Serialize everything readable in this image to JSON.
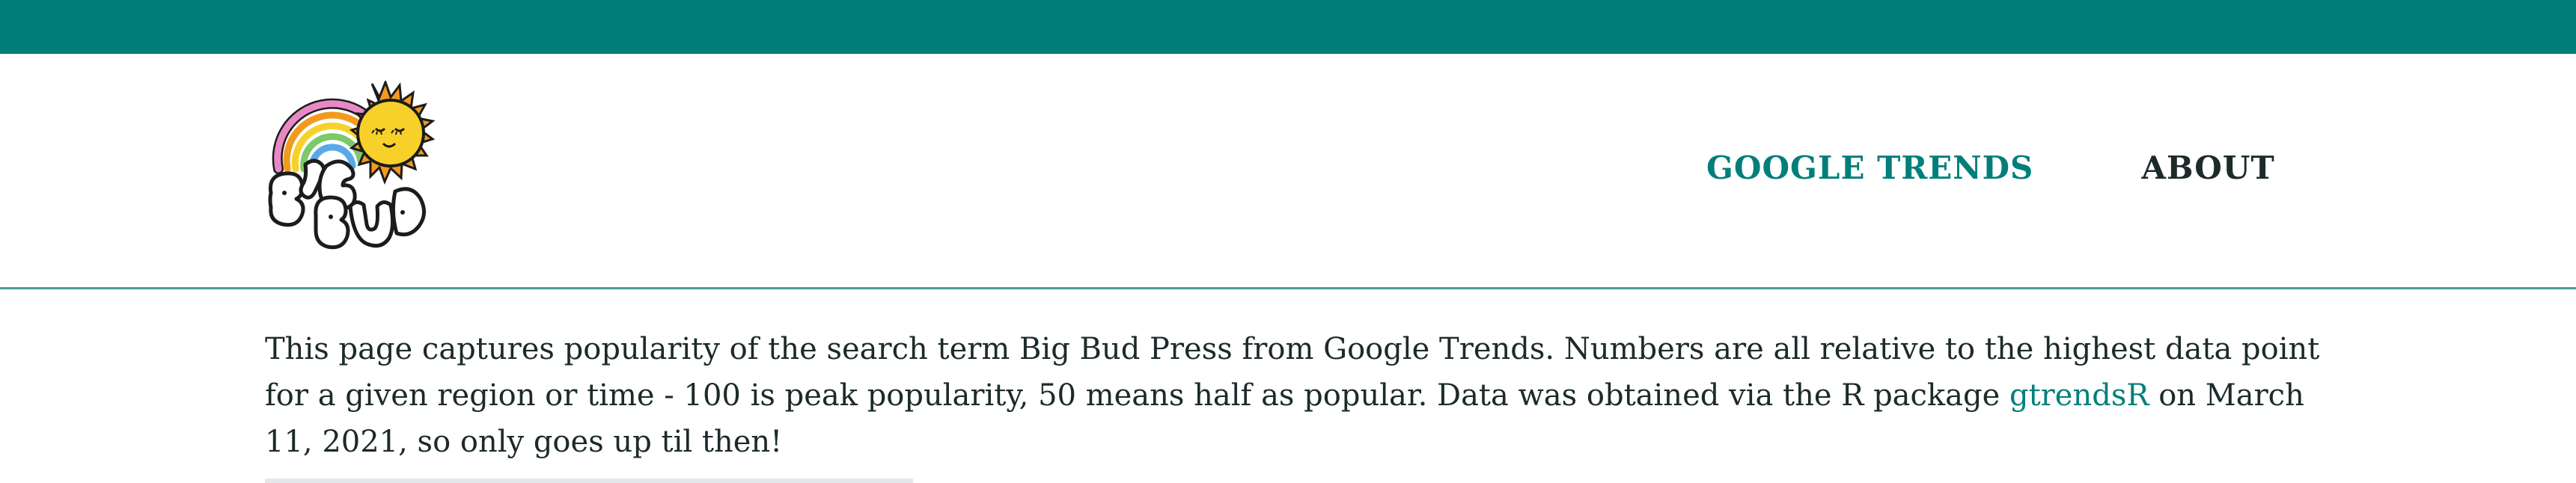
{
  "header": {
    "logo": {
      "text_top": "BIG",
      "text_bottom": "BUD",
      "colors": {
        "teal": "#007f7a",
        "sun": "#f7d12a",
        "sun_rays": "#f39a1e",
        "rainbow": [
          "#e889c6",
          "#f39a1e",
          "#f7d12a",
          "#7bc96a",
          "#5aa9e6"
        ]
      }
    },
    "nav": {
      "trends_label": "GOOGLE TRENDS",
      "about_label": "ABOUT"
    }
  },
  "intro": {
    "text_before_link": "This page captures popularity of the search term Big Bud Press from Google Trends. Numbers are all relative to the highest data point for a given region or time - 100 is peak popularity, 50 means half as popular. Data was obtained via the R package ",
    "link_text": "gtrendsR",
    "text_after_link": " on March 11, 2021, so only goes up til then!"
  }
}
